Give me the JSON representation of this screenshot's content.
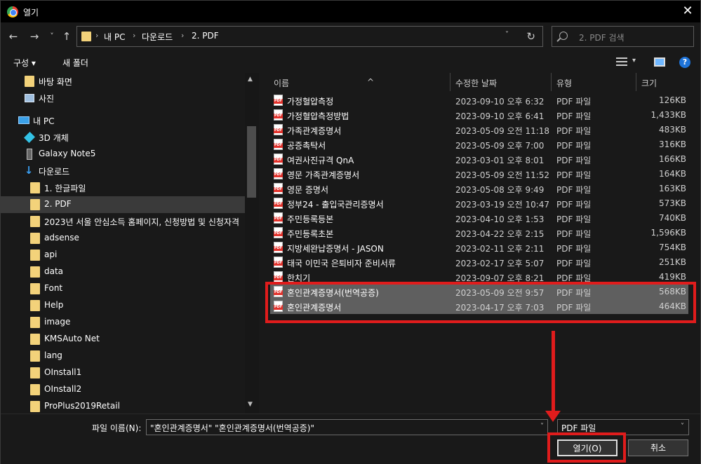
{
  "window": {
    "title": "열기",
    "close_glyph": "✕"
  },
  "nav": {
    "back_glyph": "←",
    "forward_glyph": "→",
    "recent_glyph": "˅",
    "up_glyph": "↑",
    "breadcrumbs": [
      "내 PC",
      "다운로드",
      "2. PDF"
    ],
    "crumb_sep": "›",
    "dropdown_glyph": "˅",
    "refresh_glyph": "↻",
    "search_placeholder": "2. PDF 검색"
  },
  "toolbar": {
    "organize": "구성 ▾",
    "new_folder": "새 폴더",
    "view_dd_glyph": "▾",
    "help": "?"
  },
  "sidebar": {
    "items": [
      {
        "label": "바탕 화면",
        "icon": "folder-icon"
      },
      {
        "label": "사진",
        "icon": "pictures-icon"
      },
      {
        "label": "내 PC",
        "icon": "pc-icon"
      },
      {
        "label": "3D 개체",
        "icon": "3d-objects-icon"
      },
      {
        "label": "Galaxy Note5",
        "icon": "phone-icon"
      },
      {
        "label": "다운로드",
        "icon": "download-icon"
      },
      {
        "label": "1. 한글파일",
        "icon": "folder-icon"
      },
      {
        "label": "2. PDF",
        "icon": "folder-icon",
        "selected": true
      },
      {
        "label": "2023년 서울 안심소득 홈페이지, 신청방법 및 신청자격",
        "icon": "folder-icon"
      },
      {
        "label": "adsense",
        "icon": "folder-icon"
      },
      {
        "label": "api",
        "icon": "folder-icon"
      },
      {
        "label": "data",
        "icon": "folder-icon"
      },
      {
        "label": "Font",
        "icon": "folder-icon"
      },
      {
        "label": "Help",
        "icon": "folder-icon"
      },
      {
        "label": "image",
        "icon": "folder-icon"
      },
      {
        "label": "KMSAuto Net",
        "icon": "folder-icon"
      },
      {
        "label": "lang",
        "icon": "folder-icon"
      },
      {
        "label": "OInstall1",
        "icon": "folder-icon"
      },
      {
        "label": "OInstall2",
        "icon": "folder-icon"
      },
      {
        "label": "ProPlus2019Retail",
        "icon": "folder-icon"
      }
    ],
    "scroll_up": "▲",
    "scroll_down": "▼"
  },
  "files": {
    "columns": {
      "name": "이름",
      "date": "수정한 날짜",
      "type": "유형",
      "size": "크기"
    },
    "sort_glyph": "^",
    "rows": [
      {
        "name": "가정혈압측정",
        "date": "2023-09-10 오후 6:32",
        "type": "PDF 파일",
        "size": "126KB"
      },
      {
        "name": "가정혈압측정방법",
        "date": "2023-09-10 오후 6:41",
        "type": "PDF 파일",
        "size": "1,433KB"
      },
      {
        "name": "가족관계증명서",
        "date": "2023-05-09 오전 11:18",
        "type": "PDF 파일",
        "size": "483KB"
      },
      {
        "name": "공증촉탁서",
        "date": "2023-05-09 오후 7:00",
        "type": "PDF 파일",
        "size": "316KB"
      },
      {
        "name": "여권사진규격 QnA",
        "date": "2023-03-01 오후 8:01",
        "type": "PDF 파일",
        "size": "166KB"
      },
      {
        "name": "영문 가족관계증명서",
        "date": "2023-05-09 오전 11:52",
        "type": "PDF 파일",
        "size": "164KB"
      },
      {
        "name": "영문 증명서",
        "date": "2023-05-08 오후 9:49",
        "type": "PDF 파일",
        "size": "163KB"
      },
      {
        "name": "정부24 - 출입국관리증명서",
        "date": "2023-03-19 오전 10:47",
        "type": "PDF 파일",
        "size": "573KB"
      },
      {
        "name": "주민등록등본",
        "date": "2023-04-10 오후 1:53",
        "type": "PDF 파일",
        "size": "740KB"
      },
      {
        "name": "주민등록초본",
        "date": "2023-04-22 오후 2:15",
        "type": "PDF 파일",
        "size": "1,596KB"
      },
      {
        "name": "지방세완납증명서 - JASON",
        "date": "2023-02-11 오후 2:11",
        "type": "PDF 파일",
        "size": "754KB"
      },
      {
        "name": "태국 이민국 은퇴비자 준비서류",
        "date": "2023-02-17 오후 5:07",
        "type": "PDF 파일",
        "size": "251KB"
      },
      {
        "name": "한치기",
        "date": "2023-09-07 오후 8:21",
        "type": "PDF 파일",
        "size": "419KB"
      },
      {
        "name": "혼인관계증명서(번역공증)",
        "date": "2023-05-09 오전 9:57",
        "type": "PDF 파일",
        "size": "568KB",
        "selected": true
      },
      {
        "name": "혼인관계증명서",
        "date": "2023-04-17 오후 7:03",
        "type": "PDF 파일",
        "size": "464KB",
        "selected": true
      }
    ]
  },
  "bottom": {
    "filename_label": "파일 이름(N):",
    "filename_value": "\"혼인관계증명서\" \"혼인관계증명서(번역공증)\"",
    "filetype_value": "PDF 파일",
    "dropdown_glyph": "˅",
    "open_label": "열기(O)",
    "cancel_label": "취소"
  },
  "annotation": {
    "color": "#e01c1c"
  }
}
